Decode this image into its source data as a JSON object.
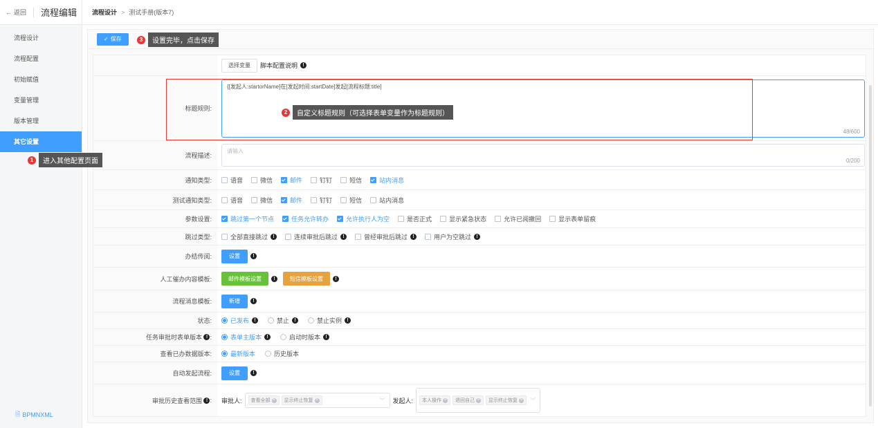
{
  "sidebar": {
    "back_label": "返回",
    "title": "流程编辑",
    "items": [
      {
        "label": "流程设计"
      },
      {
        "label": "流程配置"
      },
      {
        "label": "初始赋值"
      },
      {
        "label": "变量管理"
      },
      {
        "label": "版本管理"
      },
      {
        "label": "其它设置"
      }
    ],
    "active_index": 5,
    "footer_label": "BPMNXML"
  },
  "breadcrumb": {
    "root": "流程设计",
    "current": "测试手册(版本7)"
  },
  "toolbar": {
    "save_label": "保存"
  },
  "callouts": {
    "c1": {
      "num": "1",
      "text": "进入其他配置页面"
    },
    "c2": {
      "num": "2",
      "text": "自定义标题规则（可选择表单变量作为标题规则）"
    },
    "c3": {
      "num": "3",
      "text": "设置完毕，点击保存"
    }
  },
  "form": {
    "script_row": {
      "select_var": "选择变量",
      "explain": "脚本配置说明"
    },
    "title_rule": {
      "label": "标题规则:",
      "value": "{[发起人:startorName]在[发起时间:startDate]发起[流程标题:title]",
      "count": "48/600"
    },
    "desc": {
      "label": "流程描述:",
      "placeholder": "请输入",
      "count": "0/200"
    },
    "notify": {
      "label": "通知类型:",
      "options": [
        {
          "label": "语音",
          "checked": false
        },
        {
          "label": "微信",
          "checked": false
        },
        {
          "label": "邮件",
          "checked": true
        },
        {
          "label": "钉钉",
          "checked": false
        },
        {
          "label": "短信",
          "checked": false
        },
        {
          "label": "站内消息",
          "checked": true
        }
      ]
    },
    "test_notify": {
      "label": "测试通知类型:",
      "options": [
        {
          "label": "语音",
          "checked": false
        },
        {
          "label": "微信",
          "checked": false
        },
        {
          "label": "邮件",
          "checked": true
        },
        {
          "label": "钉钉",
          "checked": false
        },
        {
          "label": "短信",
          "checked": false
        },
        {
          "label": "站内消息",
          "checked": false
        }
      ]
    },
    "params": {
      "label": "参数设置:",
      "options": [
        {
          "label": "跳过第一个节点",
          "checked": true
        },
        {
          "label": "任务允许转办",
          "checked": true
        },
        {
          "label": "允许执行人为空",
          "checked": true
        },
        {
          "label": "是否正式",
          "checked": false
        },
        {
          "label": "显示紧急状态",
          "checked": false
        },
        {
          "label": "允许已阅撤回",
          "checked": false
        },
        {
          "label": "显示表单留痕",
          "checked": false
        }
      ]
    },
    "skip": {
      "label": "跳过类型:",
      "options": [
        {
          "label": "全部直接跳过",
          "checked": false
        },
        {
          "label": "连续审批后跳过",
          "checked": false
        },
        {
          "label": "曾经审批后跳过",
          "checked": false
        },
        {
          "label": "用户为空跳过",
          "checked": false
        }
      ]
    },
    "circulate": {
      "label": "办结传阅:",
      "button": "设置"
    },
    "urge": {
      "label": "人工催办内容模板:",
      "mail_btn": "邮件模板设置",
      "sms_btn": "短信模板设置"
    },
    "msg_tpl": {
      "label": "流程消息模板:",
      "button": "新增"
    },
    "status": {
      "label": "状态:",
      "options": [
        {
          "label": "已发布",
          "checked": true
        },
        {
          "label": "禁止",
          "checked": false
        },
        {
          "label": "禁止实例",
          "checked": false
        }
      ]
    },
    "form_version": {
      "label": "任务审批时表单版本",
      "options": [
        {
          "label": "表单主版本",
          "checked": true
        },
        {
          "label": "启动时版本",
          "checked": false
        }
      ]
    },
    "done_version": {
      "label": "查看已办数据版本:",
      "options": [
        {
          "label": "最新版本",
          "checked": true
        },
        {
          "label": "历史版本",
          "checked": false
        }
      ]
    },
    "auto_start": {
      "label": "自动发起流程:",
      "button": "设置"
    },
    "history": {
      "label": "审批历史查看范围",
      "approver_label": "审批人:",
      "approver_tags": [
        "查看全部",
        "显示终止恢复"
      ],
      "starter_label": "发起人:",
      "starter_tags": [
        "本人操作",
        "退回自己",
        "显示终止恢复"
      ]
    }
  }
}
